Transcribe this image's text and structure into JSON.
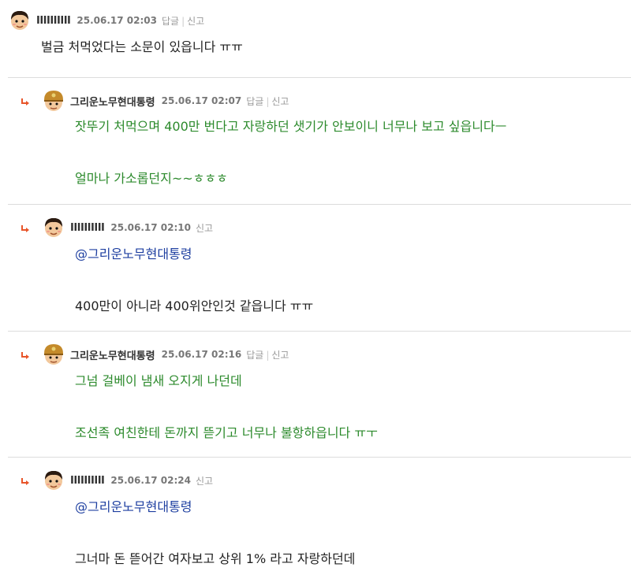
{
  "comments": [
    {
      "nickname": "IIIIIIIIII",
      "date": "25.06.17 02:03",
      "actions": [
        "답글",
        "신고"
      ],
      "lines": [
        "벌금 처먹었다는 소문이 있읍니다 ㅠㅠ"
      ]
    },
    {
      "nickname": "그리운노무현대통령",
      "date": "25.06.17 02:07",
      "actions": [
        "답글",
        "신고"
      ],
      "lines": [
        "잣뚜기 처먹으며 400만 번다고 자랑하던 샛기가 안보이니 너무나 보고 싶읍니다ㅡ",
        "얼마나 가소롭던지~~ㅎㅎㅎ"
      ]
    },
    {
      "nickname": "IIIIIIIIII",
      "date": "25.06.17 02:10",
      "actions": [
        "신고"
      ],
      "mention": "@그리운노무현대통령",
      "lines": [
        "400만이 아니라 400위안인것 같읍니다 ㅠㅠ"
      ]
    },
    {
      "nickname": "그리운노무현대통령",
      "date": "25.06.17 02:16",
      "actions": [
        "답글",
        "신고"
      ],
      "lines": [
        "그넘 걸베이 냄새 오지게 나던데",
        "조선족 여친한테 돈까지 뜯기고 너무나 불항하읍니다 ㅠㅜ"
      ]
    },
    {
      "nickname": "IIIIIIIIII",
      "date": "25.06.17 02:24",
      "actions": [
        "신고"
      ],
      "mention": "@그리운노무현대통령",
      "lines": [
        "그너마 돈 뜯어간 여자보고 상위 1% 라고 자랑하던데"
      ]
    }
  ],
  "icons": {
    "reply_arrow": "reply-arrow-icon",
    "avatar_boy": "boy-avatar-icon",
    "avatar_helmet": "helmet-avatar-icon"
  },
  "colors": {
    "green_text": "#2c8a2c",
    "blue_mention": "#1e3fa0",
    "reply_arrow": "#e8552a"
  }
}
